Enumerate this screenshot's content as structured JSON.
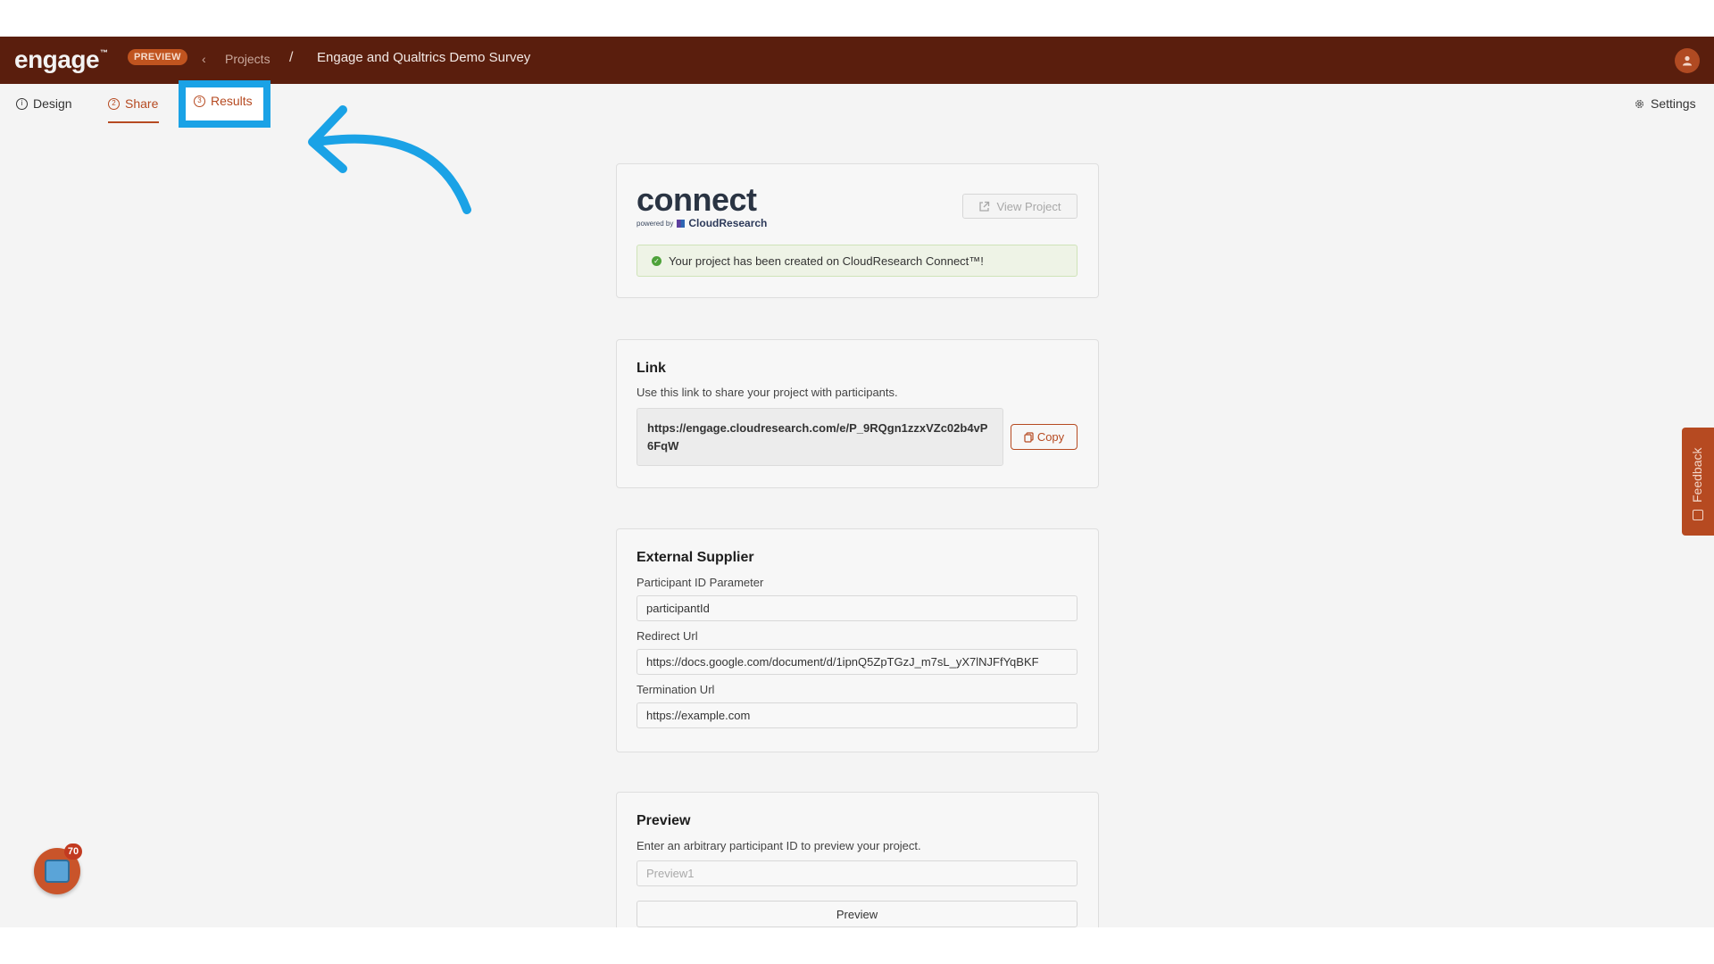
{
  "header": {
    "logo_text": "engage",
    "logo_tm": "™",
    "preview_badge": "PREVIEW",
    "back_glyph": "‹",
    "breadcrumb_projects": "Projects",
    "breadcrumb_separator": "/",
    "project_title": "Engage and Qualtrics Demo Survey",
    "user_icon": "user-icon"
  },
  "tabs": {
    "design": "Design",
    "share": "Share",
    "results": "Results",
    "settings": "Settings",
    "active": "Share",
    "highlighted": "Results"
  },
  "connect_card": {
    "logo_word": "connect",
    "logo_tm": "™",
    "powered_by": "powered by",
    "powered_brand": "CloudResearch",
    "view_project_label": "View Project",
    "success_message": "Your project has been created on CloudResearch Connect™!"
  },
  "link_card": {
    "title": "Link",
    "description": "Use this link to share your project with participants.",
    "url": "https://engage.cloudresearch.com/e/P_9RQgn1zzxVZc02b4vP6FqW",
    "copy_label": "Copy"
  },
  "supplier_card": {
    "title": "External Supplier",
    "participant_id_label": "Participant ID Parameter",
    "participant_id_value": "participantId",
    "redirect_label": "Redirect Url",
    "redirect_value": "https://docs.google.com/document/d/1ipnQ5ZpTGzJ_m7sL_yX7lNJFfYqBKF",
    "termination_label": "Termination Url",
    "termination_value": "https://example.com"
  },
  "preview_card": {
    "title": "Preview",
    "description": "Enter an arbitrary participant ID to preview your project.",
    "input_placeholder": "Preview1",
    "button_label": "Preview"
  },
  "feedback_tab": {
    "label": "Feedback"
  },
  "chat_widget": {
    "badge_count": "70"
  },
  "colors": {
    "topbar": "#5a1e0d",
    "accent": "#b64a21",
    "highlight_box": "#1aa2e6",
    "arrow": "#1aa2e6",
    "success": "#4ea23a"
  }
}
